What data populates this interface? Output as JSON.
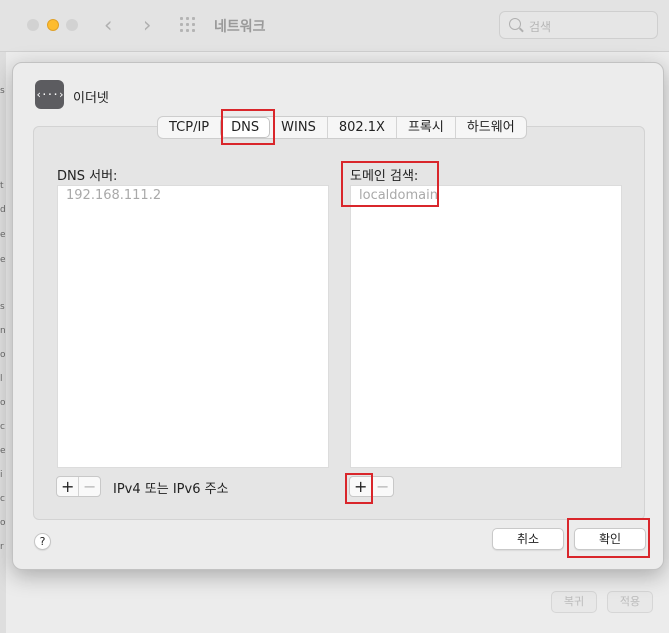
{
  "window": {
    "title": "네트워크",
    "search_placeholder": "검색",
    "nav_back_glyph": "‹",
    "nav_forward_glyph": "›",
    "bottom_buttons": {
      "revert": "복귀",
      "apply": "적용"
    }
  },
  "sidebar_fragments": [
    "s",
    "t",
    "d",
    "e",
    "e",
    "s",
    "n",
    "o",
    "l",
    "o",
    "c",
    "e",
    "i",
    "c",
    "o",
    "r",
    "o",
    "s",
    "e"
  ],
  "sheet": {
    "icon_name": "ethernet-icon",
    "icon_glyph": "‹···›",
    "title": "이더넷",
    "tabs": [
      {
        "label": "TCP/IP",
        "selected": false
      },
      {
        "label": "DNS",
        "selected": true
      },
      {
        "label": "WINS",
        "selected": false
      },
      {
        "label": "802.1X",
        "selected": false
      },
      {
        "label": "프록시",
        "selected": false
      },
      {
        "label": "하드웨어",
        "selected": false
      }
    ],
    "dns_servers": {
      "label": "DNS 서버:",
      "items": [
        "192.168.111.2"
      ],
      "hint": "IPv4 또는 IPv6 주소"
    },
    "search_domains": {
      "label": "도메인 검색:",
      "items": [
        "localdomain"
      ]
    },
    "add_glyph": "+",
    "remove_glyph": "−",
    "help_glyph": "?",
    "cancel_label": "취소",
    "ok_label": "확인"
  },
  "colors": {
    "highlight": "#d9262b",
    "minimize_button": "#febc2e"
  }
}
